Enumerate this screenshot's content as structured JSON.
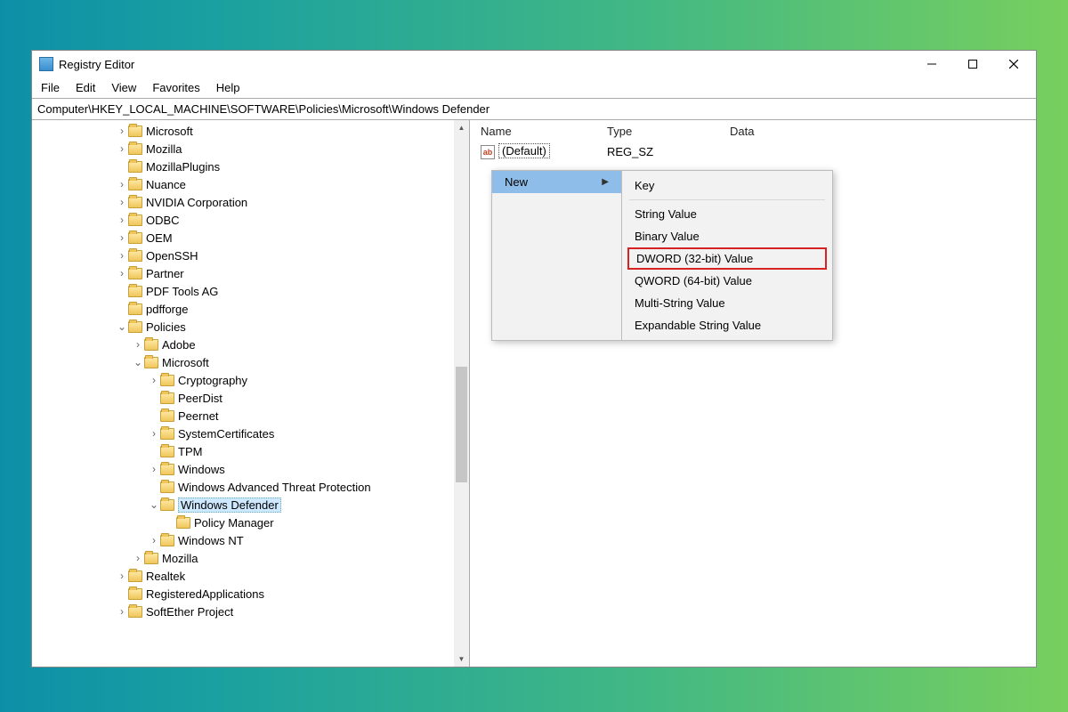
{
  "window": {
    "title": "Registry Editor"
  },
  "menu": {
    "file": "File",
    "edit": "Edit",
    "view": "View",
    "favorites": "Favorites",
    "help": "Help"
  },
  "address": "Computer\\HKEY_LOCAL_MACHINE\\SOFTWARE\\Policies\\Microsoft\\Windows Defender",
  "tree": [
    {
      "label": "Microsoft",
      "depth": 3,
      "exp": ">"
    },
    {
      "label": "Mozilla",
      "depth": 3,
      "exp": ">"
    },
    {
      "label": "MozillaPlugins",
      "depth": 3,
      "exp": ""
    },
    {
      "label": "Nuance",
      "depth": 3,
      "exp": ">"
    },
    {
      "label": "NVIDIA Corporation",
      "depth": 3,
      "exp": ">"
    },
    {
      "label": "ODBC",
      "depth": 3,
      "exp": ">"
    },
    {
      "label": "OEM",
      "depth": 3,
      "exp": ">"
    },
    {
      "label": "OpenSSH",
      "depth": 3,
      "exp": ">"
    },
    {
      "label": "Partner",
      "depth": 3,
      "exp": ">"
    },
    {
      "label": "PDF Tools AG",
      "depth": 3,
      "exp": ""
    },
    {
      "label": "pdfforge",
      "depth": 3,
      "exp": ""
    },
    {
      "label": "Policies",
      "depth": 3,
      "exp": "v"
    },
    {
      "label": "Adobe",
      "depth": 4,
      "exp": ">"
    },
    {
      "label": "Microsoft",
      "depth": 4,
      "exp": "v"
    },
    {
      "label": "Cryptography",
      "depth": 5,
      "exp": ">"
    },
    {
      "label": "PeerDist",
      "depth": 5,
      "exp": ""
    },
    {
      "label": "Peernet",
      "depth": 5,
      "exp": ""
    },
    {
      "label": "SystemCertificates",
      "depth": 5,
      "exp": ">"
    },
    {
      "label": "TPM",
      "depth": 5,
      "exp": ""
    },
    {
      "label": "Windows",
      "depth": 5,
      "exp": ">"
    },
    {
      "label": "Windows Advanced Threat Protection",
      "depth": 5,
      "exp": ""
    },
    {
      "label": "Windows Defender",
      "depth": 5,
      "exp": "v",
      "selected": true
    },
    {
      "label": "Policy Manager",
      "depth": 6,
      "exp": ""
    },
    {
      "label": "Windows NT",
      "depth": 5,
      "exp": ">"
    },
    {
      "label": "Mozilla",
      "depth": 4,
      "exp": ">"
    },
    {
      "label": "Realtek",
      "depth": 3,
      "exp": ">"
    },
    {
      "label": "RegisteredApplications",
      "depth": 3,
      "exp": ""
    },
    {
      "label": "SoftEther Project",
      "depth": 3,
      "exp": ">"
    }
  ],
  "columns": {
    "name": "Name",
    "type": "Type",
    "data": "Data"
  },
  "values": [
    {
      "name": "(Default)",
      "type": "REG_SZ",
      "data": ""
    }
  ],
  "context": {
    "parent": "New",
    "items": [
      {
        "label": "Key",
        "sep_after": true
      },
      {
        "label": "String Value"
      },
      {
        "label": "Binary Value"
      },
      {
        "label": "DWORD (32-bit) Value",
        "highlight": true
      },
      {
        "label": "QWORD (64-bit) Value"
      },
      {
        "label": "Multi-String Value"
      },
      {
        "label": "Expandable String Value"
      }
    ]
  }
}
